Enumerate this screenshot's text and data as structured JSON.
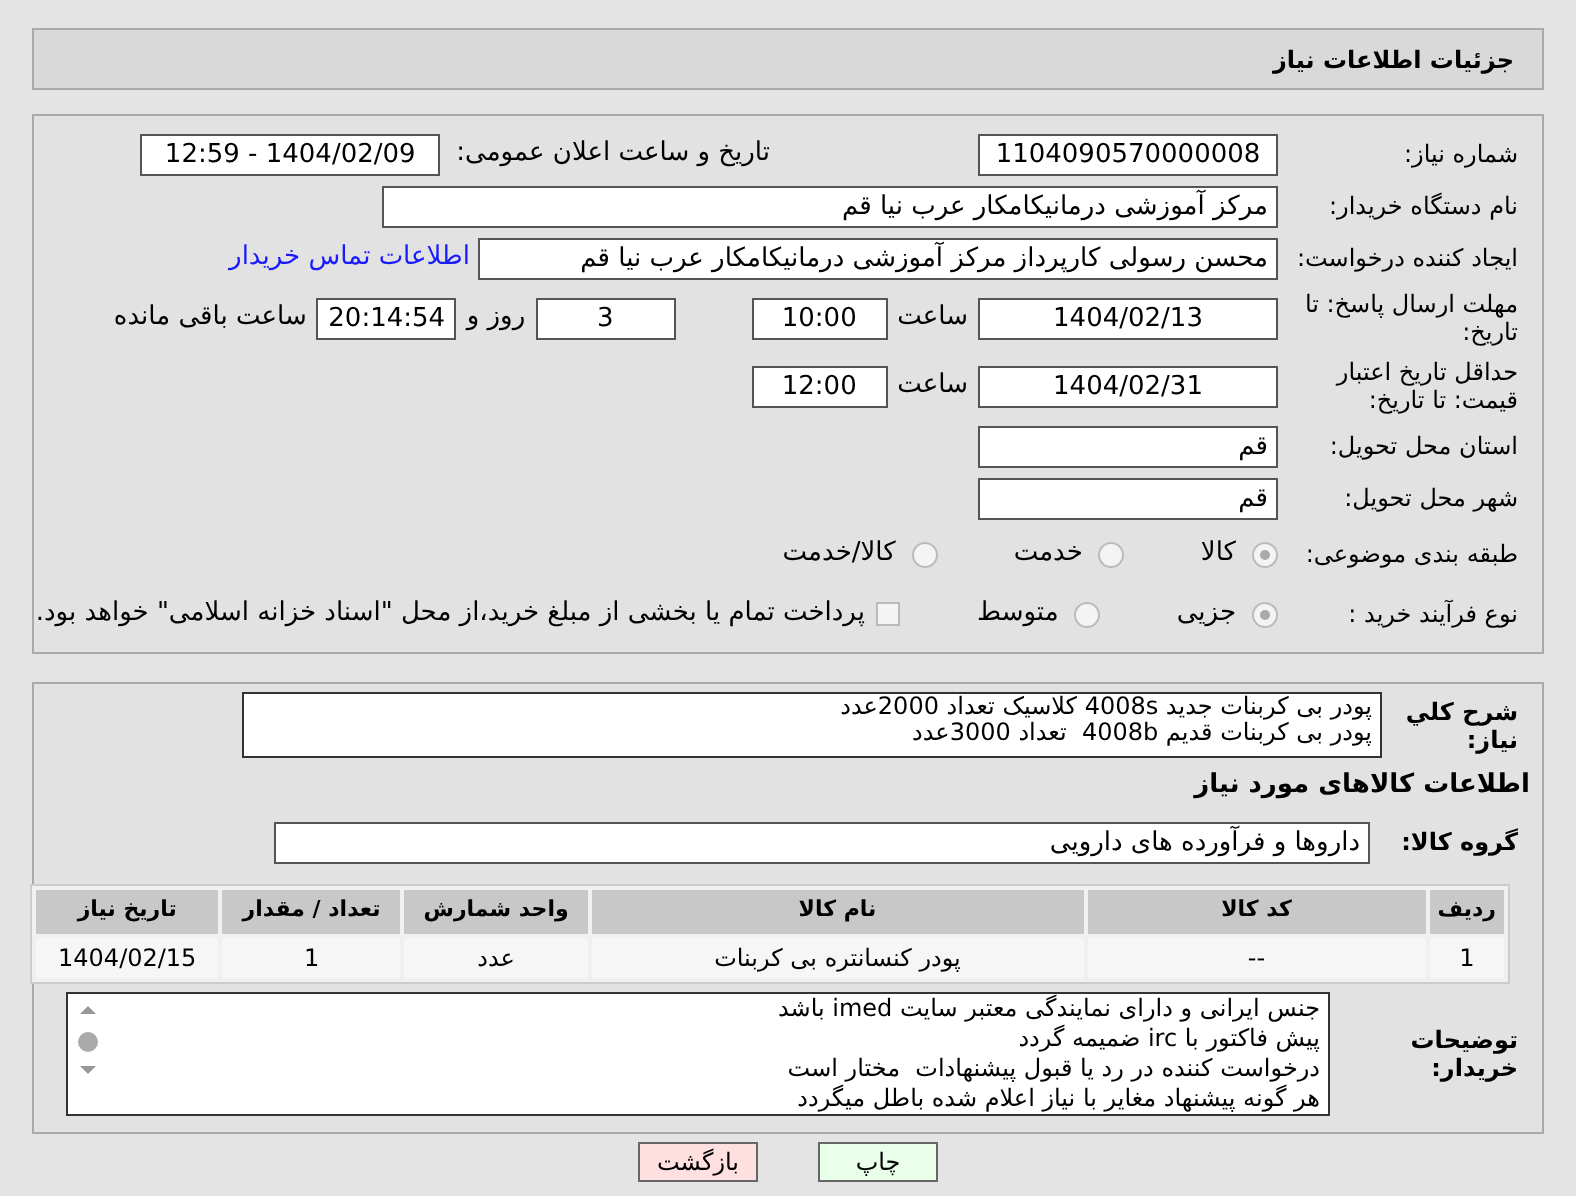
{
  "header": {
    "title": "جزئیات اطلاعات نیاز"
  },
  "need_number": {
    "label": "شماره نیاز:",
    "value": "1104090570000008"
  },
  "announce": {
    "label": "تاریخ و ساعت اعلان عمومی:",
    "value": "1404/02/09 - 12:59"
  },
  "buyer": {
    "label": "نام دستگاه خریدار:",
    "value": "مرکز آموزشی درمانیکامکار عرب نیا قم"
  },
  "creator": {
    "label": "ایجاد کننده درخواست:",
    "value": "محسن رسولی کارپرداز مرکز آموزشی درمانیکامکار عرب نیا قم",
    "link": "اطلاعات تماس خریدار"
  },
  "deadline": {
    "label": "مهلت ارسال پاسخ: تا تاریخ:",
    "date": "1404/02/13",
    "time_label": "ساعت",
    "time": "10:00",
    "days": "3",
    "days_label": "روز و",
    "remaining": "20:14:54",
    "remaining_label": "ساعت باقی مانده"
  },
  "validity": {
    "label": "حداقل تاریخ اعتبار قیمت: تا تاریخ:",
    "date": "1404/02/31",
    "time_label": "ساعت",
    "time": "12:00"
  },
  "province": {
    "label": "استان محل تحویل:",
    "value": "قم"
  },
  "city": {
    "label": "شهر محل تحویل:",
    "value": "قم"
  },
  "category": {
    "label": "طبقه بندی موضوعی:",
    "options": [
      {
        "label": "کالا",
        "selected": true
      },
      {
        "label": "خدمت",
        "selected": false
      },
      {
        "label": "کالا/خدمت",
        "selected": false
      }
    ]
  },
  "purchase_type": {
    "label": "نوع فرآیند خرید :",
    "options": [
      {
        "label": "جزیی",
        "selected": true
      },
      {
        "label": "متوسط",
        "selected": false
      }
    ],
    "payment": {
      "checked": false,
      "text": "پرداخت تمام یا بخشی از مبلغ خرید،از محل \"اسناد خزانه اسلامی\" خواهد بود."
    }
  },
  "description": {
    "label": "شرح کلي نیاز:",
    "lines": [
      "پودر بی کربنات جدید 4008s کلاسیک تعداد 2000عدد",
      "پودر بی کربنات قدیم 4008b  تعداد 3000عدد"
    ]
  },
  "goods_heading": "اطلاعات کالاهای مورد نیاز",
  "goods_group": {
    "label": "گروه کالا:",
    "value": "داروها و فرآورده های دارویی"
  },
  "table": {
    "columns": [
      "ردیف",
      "کد کالا",
      "نام کالا",
      "واحد شمارش",
      "تعداد / مقدار",
      "تاریخ نیاز"
    ],
    "rows": [
      [
        "1",
        "--",
        "پودر کنسانتره بی کربنات",
        "عدد",
        "1",
        "1404/02/15"
      ]
    ]
  },
  "notes": {
    "label": "توضیحات خریدار:",
    "lines": [
      "جنس ایرانی و دارای نمایندگی معتبر سایت imed باشد",
      "پیش فاکتور با irc ضمیمه گردد",
      "درخواست کننده در رد یا قبول پیشنهادات  مختار است",
      "هر گونه پیشنهاد مغایر با نیاز اعلام شده باطل میگردد"
    ]
  },
  "buttons": [
    {
      "label": "چاپ",
      "kind": "print"
    },
    {
      "label": "بازگشت",
      "kind": "back"
    }
  ]
}
